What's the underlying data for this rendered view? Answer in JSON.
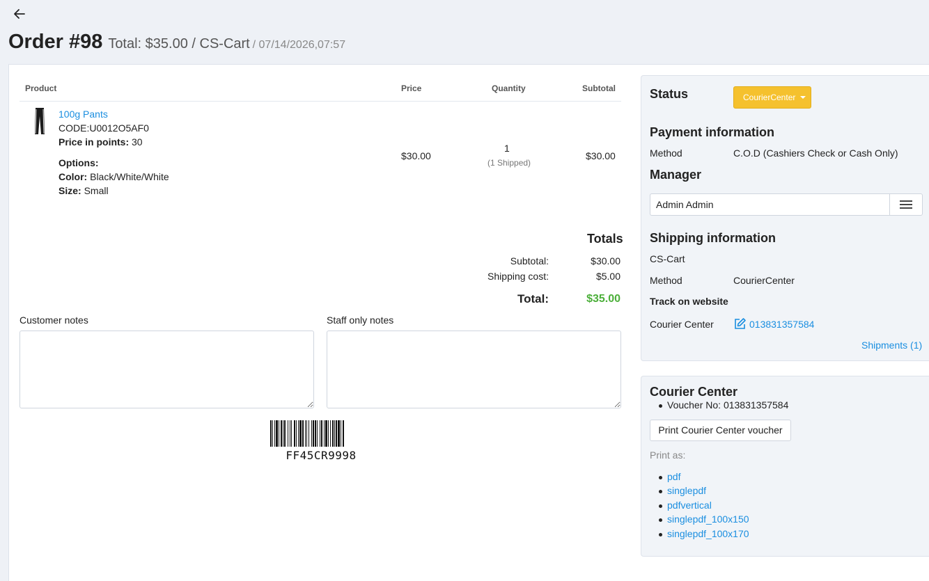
{
  "header": {
    "order_title": "Order #98",
    "order_total": "Total: $35.00 / CS-Cart",
    "order_date": "/ 07/14/2026,07:57"
  },
  "table": {
    "headers": {
      "product": "Product",
      "price": "Price",
      "quantity": "Quantity",
      "subtotal": "Subtotal"
    },
    "product": {
      "name": "100g Pants",
      "code": "CODE:U0012O5AF0",
      "points_label": "Price in points:",
      "points_value": "30",
      "options_label": "Options:",
      "color_label": "Color:",
      "color_value": "Black/White/White",
      "size_label": "Size:",
      "size_value": "Small",
      "price": "$30.00",
      "quantity": "1",
      "shipped": "(1 Shipped)",
      "subtotal": "$30.00"
    }
  },
  "totals": {
    "title": "Totals",
    "subtotal_label": "Subtotal:",
    "subtotal_value": "$30.00",
    "shipping_label": "Shipping cost:",
    "shipping_value": "$5.00",
    "total_label": "Total:",
    "total_value": "$35.00"
  },
  "notes": {
    "customer_label": "Customer notes",
    "staff_label": "Staff only notes"
  },
  "barcode": {
    "text": "FF45CR9998"
  },
  "status_panel": {
    "status_title": "Status",
    "status_value": "CourierCenter",
    "payment_title": "Payment information",
    "method_label": "Method",
    "payment_method": "C.O.D (Cashiers Check or Cash Only)",
    "manager_title": "Manager",
    "manager_value": "Admin Admin",
    "shipping_title": "Shipping information",
    "shipping_company": "CS-Cart",
    "shipping_method_label": "Method",
    "shipping_method": "CourierCenter",
    "track_label": "Track on website",
    "carrier_label": "Courier Center",
    "tracking_number": "013831357584",
    "shipments_link": "Shipments (1)"
  },
  "courier_panel": {
    "title": "Courier Center",
    "voucher": "Voucher No: 013831357584",
    "print_button": "Print Courier Center voucher",
    "print_as_label": "Print as:",
    "print_options": [
      "pdf",
      "singlepdf",
      "pdfvertical",
      "singlepdf_100x150",
      "singlepdf_100x170"
    ]
  },
  "colors": {
    "accent_link": "#1a8ee0",
    "status_button": "#f5c12e",
    "total_green": "#4caf3a"
  },
  "icons": [
    "back-arrow-icon",
    "edit-icon",
    "menu-icon",
    "product-thumbnail"
  ]
}
